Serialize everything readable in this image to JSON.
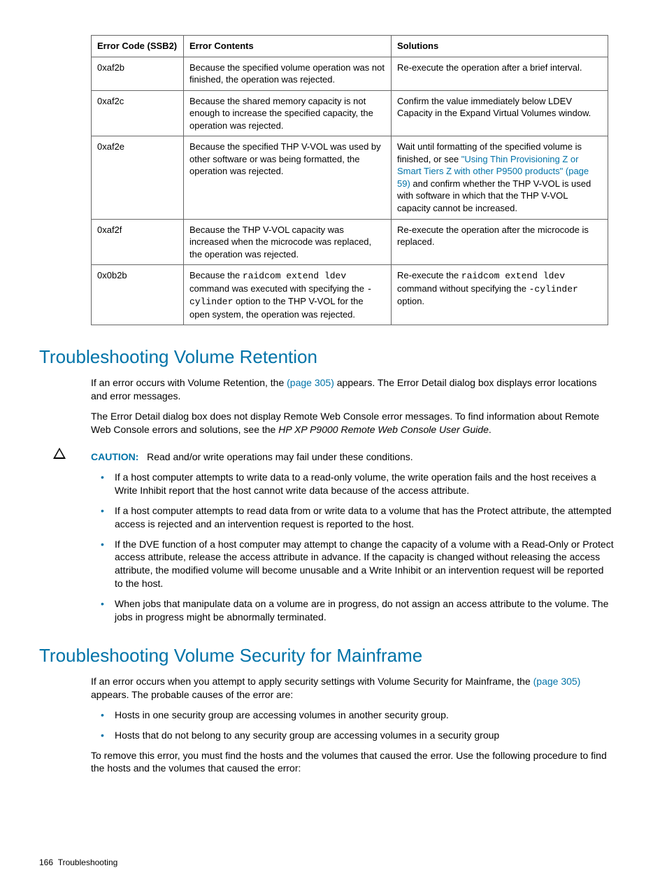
{
  "table": {
    "headers": [
      "Error Code (SSB2)",
      "Error Contents",
      "Solutions"
    ],
    "rows": [
      {
        "code": "0xaf2b",
        "contents": "Because the specified volume operation was not finished, the operation was rejected.",
        "solution": "Re-execute the operation after a brief interval."
      },
      {
        "code": "0xaf2c",
        "contents": "Because the shared memory capacity is not enough to increase the specified capacity, the operation was rejected.",
        "solution": "Confirm the value immediately below LDEV Capacity in the Expand Virtual Volumes window."
      },
      {
        "code": "0xaf2e",
        "contents": "Because the specified THP V-VOL was used by other software or was being formatted, the operation was rejected.",
        "solution_pre": "Wait until formatting of the specified volume is finished, or see ",
        "solution_link": "\"Using Thin Provisioning Z or Smart Tiers Z with other P9500 products\" (page 59)",
        "solution_post": " and confirm whether the THP V-VOL is used with software in which that the THP V-VOL capacity cannot be increased."
      },
      {
        "code": "0xaf2f",
        "contents": "Because the THP V-VOL capacity was increased when the microcode was replaced, the operation was rejected.",
        "solution": "Re-execute the operation after the microcode is replaced."
      },
      {
        "code": "0x0b2b",
        "c_pre": "Because the ",
        "c_code1": "raidcom extend ldev",
        "c_mid": " command was executed with specifying the ",
        "c_code2": "-cylinder",
        "c_post": " option to the THP V-VOL for the open system, the operation was rejected.",
        "s_pre": "Re-execute the ",
        "s_code1": "raidcom extend ldev",
        "s_mid": " command without specifying the ",
        "s_code2": "-cylinder",
        "s_post": " option."
      }
    ]
  },
  "section1": {
    "heading": "Troubleshooting Volume Retention",
    "p1_pre": "If an error occurs with Volume Retention, the ",
    "p1_link": "(page 305)",
    "p1_post": " appears. The Error Detail dialog box displays error locations and error messages.",
    "p2_pre": "The Error Detail dialog box does not display Remote Web Console error messages. To find information about Remote Web Console errors and solutions, see the ",
    "p2_italic": "HP XP P9000 Remote Web Console User Guide",
    "p2_post": ".",
    "caution_label": "CAUTION:",
    "caution_text": "Read and/or write operations may fail under these conditions.",
    "bullets": [
      "If a host computer attempts to write data to a read-only volume, the write operation fails and the host receives a Write Inhibit report that the host cannot write data because of the access attribute.",
      "If a host computer attempts to read data from or write data to a volume that has the Protect attribute, the attempted access is rejected and an intervention request is reported to the host.",
      "If the DVE function of a host computer may attempt to change the capacity of a volume with a Read-Only or Protect access attribute, release the access attribute in advance. If the capacity is changed without releasing the access attribute, the modified volume will become unusable and a Write Inhibit or an intervention request will be reported to the host.",
      "When jobs that manipulate data on a volume are in progress, do not assign an access attribute to the volume. The jobs in progress might be abnormally terminated."
    ]
  },
  "section2": {
    "heading": "Troubleshooting Volume Security for Mainframe",
    "p1_pre": "If an error occurs when you attempt to apply security settings with Volume Security for Mainframe, the ",
    "p1_link": "(page 305)",
    "p1_post": " appears. The probable causes of the error are:",
    "bullets": [
      "Hosts in one security group are accessing volumes in another security group.",
      "Hosts that do not belong to any security group are accessing volumes in a security group"
    ],
    "p2": "To remove this error, you must find the hosts and the volumes that caused the error. Use the following procedure to find the hosts and the volumes that caused the error:"
  },
  "footer": {
    "page": "166",
    "label": "Troubleshooting"
  }
}
